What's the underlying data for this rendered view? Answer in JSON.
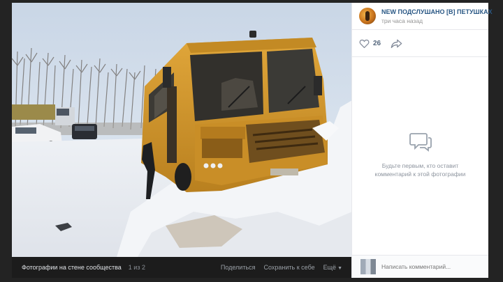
{
  "post": {
    "community_name": "NEW ПОДСЛУШАНО [В] ПЕТУШКАХ",
    "time": "три часа назад",
    "likes": "26"
  },
  "comments": {
    "empty_text": "Будьте первым, кто оставит комментарий к этой фотографии",
    "input_placeholder": "Написать комментарий..."
  },
  "photo_bar": {
    "title": "Фотографии на стене сообщества",
    "counter": "1 из 2",
    "share_label": "Поделиться",
    "save_label": "Сохранить к себе",
    "more_label": "Ещё"
  },
  "colors": {
    "link": "#2a5885",
    "bus": "#d99a2b"
  },
  "icons": {
    "like": "heart-outline-icon",
    "share": "share-arrow-icon",
    "comments": "speech-bubbles-icon",
    "more": "chevron-down-icon"
  }
}
